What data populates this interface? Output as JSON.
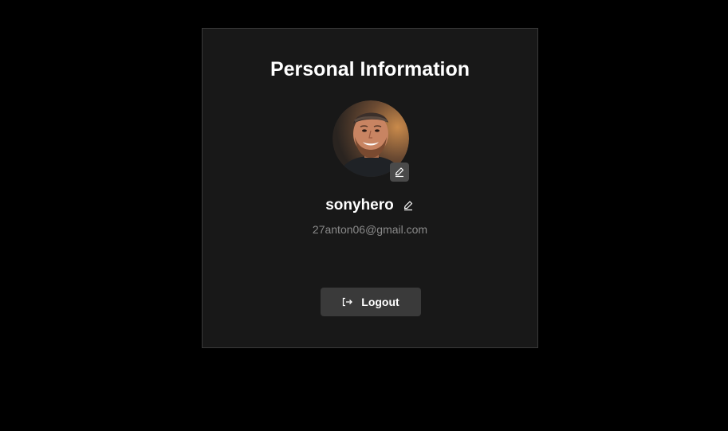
{
  "card": {
    "title": "Personal Information"
  },
  "profile": {
    "avatar_icon": "user-photo",
    "avatar_edit_icon": "pencil-icon",
    "username": "sonyhero",
    "username_edit_icon": "pencil-icon",
    "email": "27anton06@gmail.com"
  },
  "actions": {
    "logout_label": "Logout",
    "logout_icon": "logout-icon"
  },
  "colors": {
    "background": "#000000",
    "card": "#181818",
    "button": "#3a3a3a",
    "muted_text": "#8a8a8a"
  }
}
